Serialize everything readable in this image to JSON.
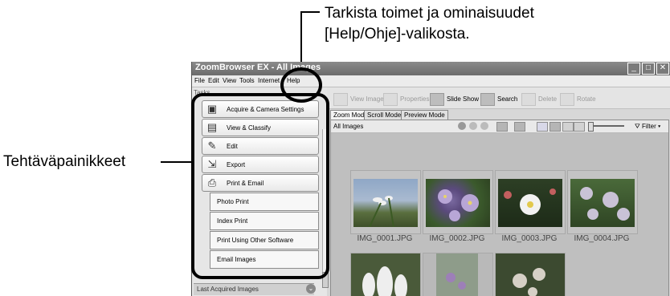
{
  "callouts": {
    "help_line1": "Tarkista toimet ja ominaisuudet",
    "help_line2": "[Help/Ohje]-valikosta.",
    "task_buttons": "Tehtäväpainikkeet"
  },
  "window": {
    "title": "ZoomBrowser EX - All Images",
    "menu": [
      "File",
      "Edit",
      "View",
      "Tools",
      "Internet",
      "Help"
    ]
  },
  "taskpane": {
    "heading": "Tasks",
    "tasks": [
      {
        "label": "Acquire & Camera Settings",
        "icon": "camera-icon"
      },
      {
        "label": "View & Classify",
        "icon": "folder-icon"
      },
      {
        "label": "Edit",
        "icon": "pencil-icon"
      },
      {
        "label": "Export",
        "icon": "export-icon"
      },
      {
        "label": "Print & Email",
        "icon": "printer-icon"
      }
    ],
    "subtasks": [
      "Photo Print",
      "Index Print",
      "Print Using Other Software",
      "Email Images"
    ],
    "last_acquired": "Last Acquired Images"
  },
  "toolbar": {
    "view_image": "View Image",
    "properties": "Properties",
    "slide_show": "Slide Show",
    "search": "Search",
    "delete": "Delete",
    "rotate": "Rotate"
  },
  "modes": [
    "Zoom Mode",
    "Scroll Mode",
    "Preview Mode"
  ],
  "viewer": {
    "folder_label": "All Images",
    "filter_label": "Filter",
    "images": [
      {
        "name": "IMG_0001.JPG"
      },
      {
        "name": "IMG_0002.JPG"
      },
      {
        "name": "IMG_0003.JPG"
      },
      {
        "name": "IMG_0004.JPG"
      }
    ]
  },
  "colors": {
    "titlebar": "#6c6c6c",
    "highlight_ring": "#000000"
  }
}
